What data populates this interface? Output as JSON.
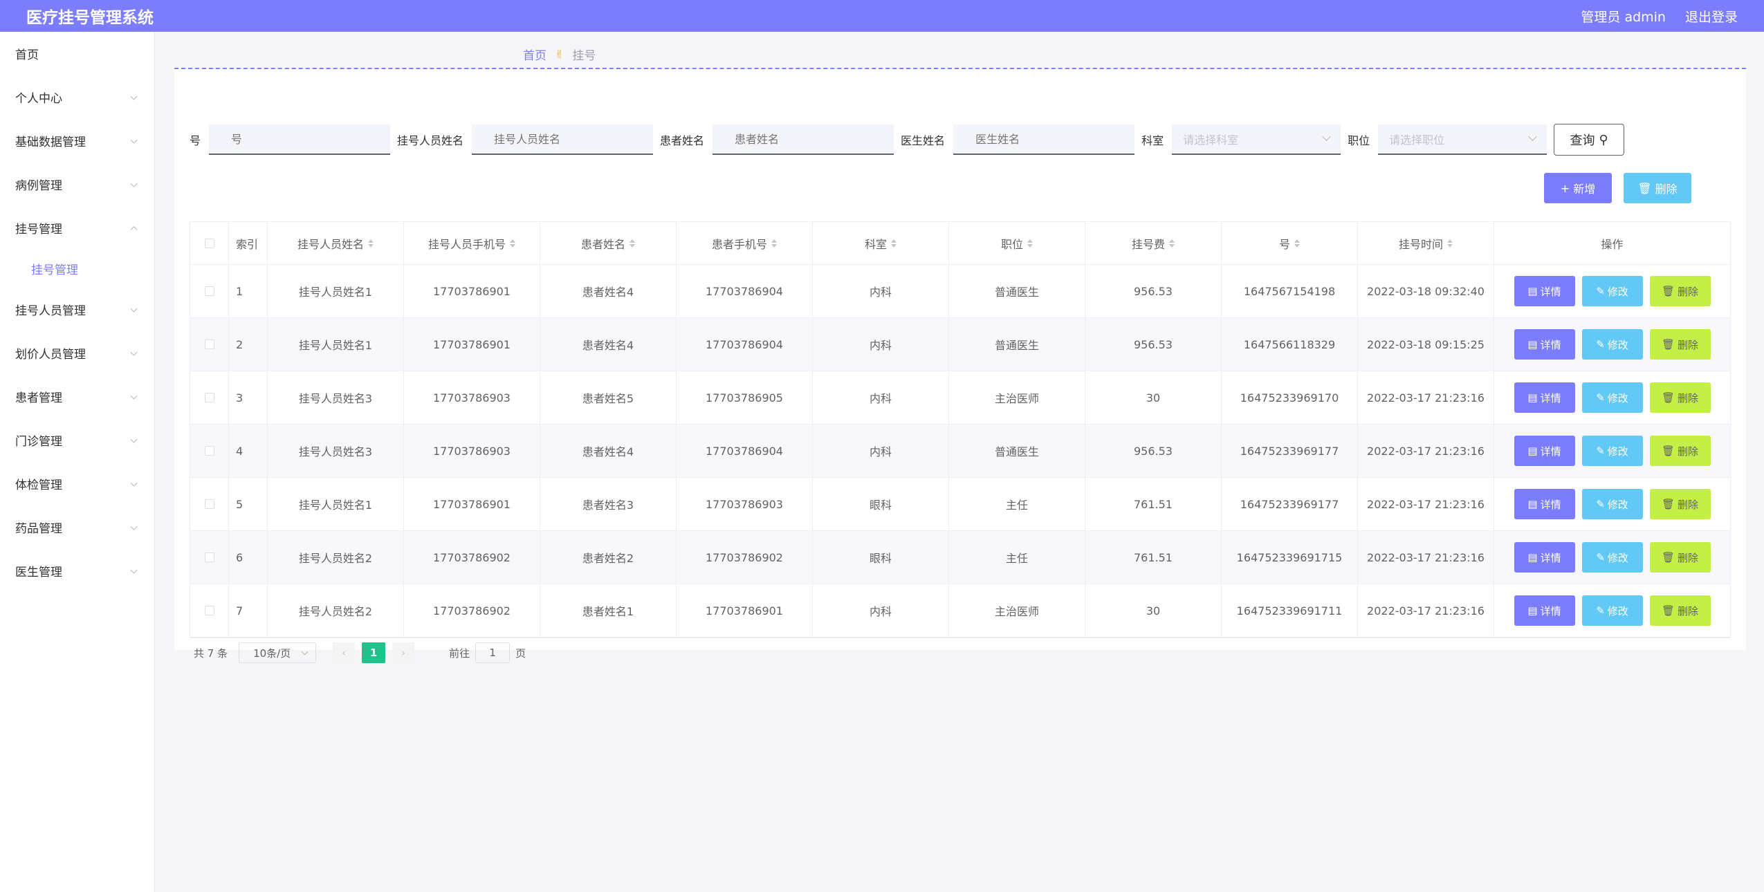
{
  "header": {
    "title": "医疗挂号管理系统",
    "user": "管理员 admin",
    "logout": "退出登录"
  },
  "sidebar": {
    "items": [
      {
        "label": "首页"
      },
      {
        "label": "个人中心"
      },
      {
        "label": "基础数据管理"
      },
      {
        "label": "病例管理"
      },
      {
        "label": "挂号管理"
      },
      {
        "label": "挂号人员管理"
      },
      {
        "label": "划价人员管理"
      },
      {
        "label": "患者管理"
      },
      {
        "label": "门诊管理"
      },
      {
        "label": "体检管理"
      },
      {
        "label": "药品管理"
      },
      {
        "label": "医生管理"
      }
    ],
    "subitem": "挂号管理"
  },
  "breadcrumb": {
    "home": "首页",
    "current": "挂号"
  },
  "search": {
    "f1_label": "号",
    "f1_ph": "号",
    "f2_label": "挂号人员姓名",
    "f2_ph": "挂号人员姓名",
    "f3_label": "患者姓名",
    "f3_ph": "患者姓名",
    "f4_label": "医生姓名",
    "f4_ph": "医生姓名",
    "f5_label": "科室",
    "f5_ph": "请选择科室",
    "f6_label": "职位",
    "f6_ph": "请选择职位",
    "query": "查询"
  },
  "actions": {
    "add": "新增",
    "delete": "删除"
  },
  "table": {
    "headers": [
      "索引",
      "挂号人员姓名",
      "挂号人员手机号",
      "患者姓名",
      "患者手机号",
      "科室",
      "职位",
      "挂号费",
      "号",
      "挂号时间",
      "操作"
    ],
    "rows": [
      [
        "1",
        "挂号人员姓名1",
        "17703786901",
        "患者姓名4",
        "17703786904",
        "内科",
        "普通医生",
        "956.53",
        "1647567154198",
        "2022-03-18 09:32:40"
      ],
      [
        "2",
        "挂号人员姓名1",
        "17703786901",
        "患者姓名4",
        "17703786904",
        "内科",
        "普通医生",
        "956.53",
        "1647566118329",
        "2022-03-18 09:15:25"
      ],
      [
        "3",
        "挂号人员姓名3",
        "17703786903",
        "患者姓名5",
        "17703786905",
        "内科",
        "主治医师",
        "30",
        "16475233969170",
        "2022-03-17 21:23:16"
      ],
      [
        "4",
        "挂号人员姓名3",
        "17703786903",
        "患者姓名4",
        "17703786904",
        "内科",
        "普通医生",
        "956.53",
        "16475233969177",
        "2022-03-17 21:23:16"
      ],
      [
        "5",
        "挂号人员姓名1",
        "17703786901",
        "患者姓名3",
        "17703786903",
        "眼科",
        "主任",
        "761.51",
        "16475233969177",
        "2022-03-17 21:23:16"
      ],
      [
        "6",
        "挂号人员姓名2",
        "17703786902",
        "患者姓名2",
        "17703786902",
        "眼科",
        "主任",
        "761.51",
        "164752339691715",
        "2022-03-17 21:23:16"
      ],
      [
        "7",
        "挂号人员姓名2",
        "17703786902",
        "患者姓名1",
        "17703786901",
        "内科",
        "主治医师",
        "30",
        "164752339691711",
        "2022-03-17 21:23:16"
      ]
    ],
    "ops": {
      "detail": "详情",
      "edit": "修改",
      "delete": "删除"
    }
  },
  "pager": {
    "total": "共 7 条",
    "size": "10条/页",
    "page": "1",
    "goto": "前往",
    "goto_value": "1",
    "unit": "页"
  },
  "colors": {
    "accent": "#7b7dfd",
    "info": "#62c8f6",
    "lime": "#c4f045",
    "green": "#1ec38c"
  }
}
